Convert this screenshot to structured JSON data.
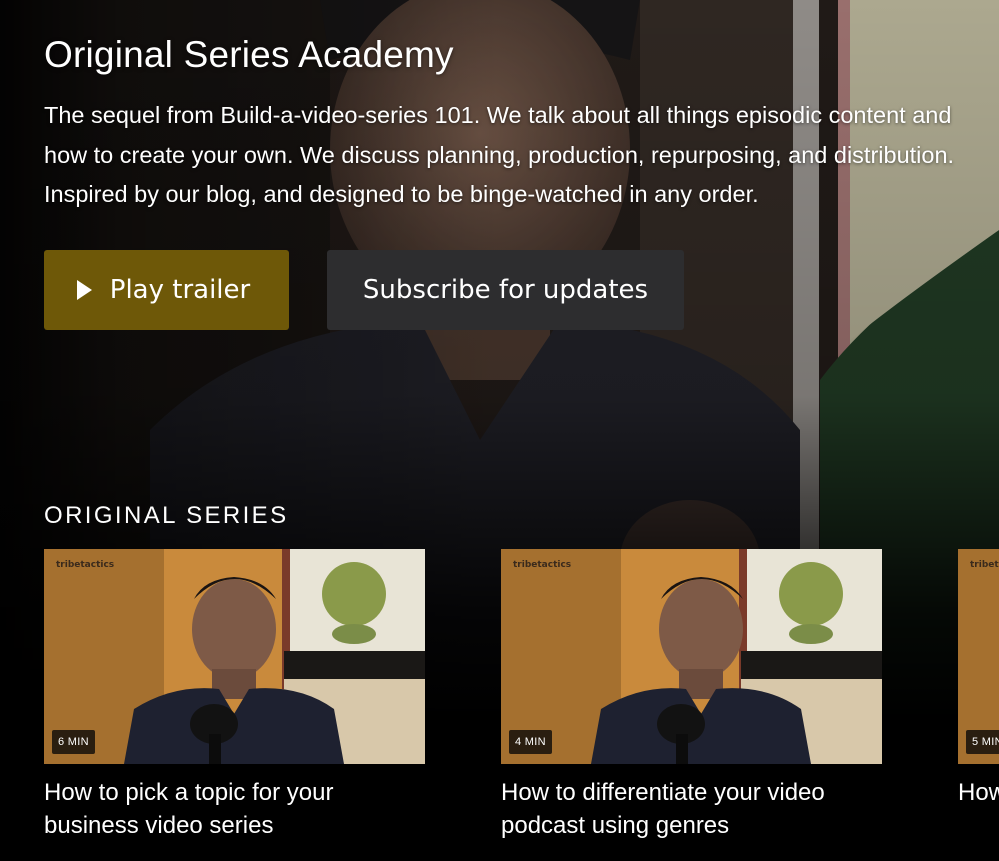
{
  "hero": {
    "title": "Original Series Academy",
    "description": "The sequel from Build-a-video-series 101. We talk about all things episodic content and how to create your own. We discuss planning, production, repurposing, and distribution. Inspired by our blog, and designed to be binge-watched in any order.",
    "play_button_label": "Play trailer",
    "subscribe_button_label": "Subscribe for updates"
  },
  "section": {
    "heading": "ORIGINAL SERIES"
  },
  "cards": [
    {
      "duration": "6 MIN",
      "watermark": "tribetactics",
      "title": "How to pick a topic for your business video series"
    },
    {
      "duration": "4 MIN",
      "watermark": "tribetactics",
      "title": "How to differentiate your video podcast using genres"
    },
    {
      "duration": "5 MIN",
      "watermark": "tribetactics",
      "title": "How synd"
    }
  ],
  "colors": {
    "play_button": "#6e5808",
    "subscribe_button": "#2d2d2f",
    "background": "#000000"
  },
  "icons": {
    "play": "play-triangle-icon"
  }
}
